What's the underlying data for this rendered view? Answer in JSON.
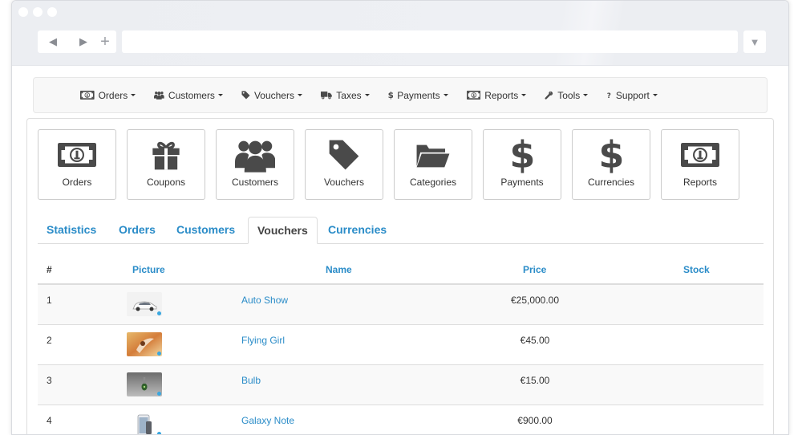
{
  "navbar": {
    "items": [
      {
        "label": "Orders",
        "icon": "money-icon"
      },
      {
        "label": "Customers",
        "icon": "users-icon"
      },
      {
        "label": "Vouchers",
        "icon": "tag-icon"
      },
      {
        "label": "Taxes",
        "icon": "truck-icon"
      },
      {
        "label": "Payments",
        "icon": "dollar-icon"
      },
      {
        "label": "Reports",
        "icon": "money-icon"
      },
      {
        "label": "Tools",
        "icon": "wrench-icon"
      },
      {
        "label": "Support",
        "icon": "question-icon"
      }
    ]
  },
  "tiles": [
    {
      "label": "Orders",
      "icon": "money-icon"
    },
    {
      "label": "Coupons",
      "icon": "gift-icon"
    },
    {
      "label": "Customers",
      "icon": "users-icon"
    },
    {
      "label": "Vouchers",
      "icon": "tag-icon"
    },
    {
      "label": "Categories",
      "icon": "folder-open-icon"
    },
    {
      "label": "Payments",
      "icon": "dollar-icon"
    },
    {
      "label": "Currencies",
      "icon": "dollar-icon"
    },
    {
      "label": "Reports",
      "icon": "money-icon"
    }
  ],
  "tabs": [
    {
      "label": "Statistics",
      "active": false
    },
    {
      "label": "Orders",
      "active": false
    },
    {
      "label": "Customers",
      "active": false
    },
    {
      "label": "Vouchers",
      "active": true
    },
    {
      "label": "Currencies",
      "active": false
    }
  ],
  "table": {
    "headers": {
      "num": "#",
      "picture": "Picture",
      "name": "Name",
      "price": "Price",
      "stock": "Stock"
    },
    "rows": [
      {
        "num": "1",
        "name": "Auto Show",
        "price": "€25,000.00",
        "thumb": "car-thumbnail"
      },
      {
        "num": "2",
        "name": "Flying Girl",
        "price": "€45.00",
        "thumb": "flying-girl-thumbnail"
      },
      {
        "num": "3",
        "name": "Bulb",
        "price": "€15.00",
        "thumb": "bulb-thumbnail"
      },
      {
        "num": "4",
        "name": "Galaxy Note",
        "price": "€900.00",
        "thumb": "phone-thumbnail"
      }
    ]
  },
  "colors": {
    "link": "#2a8cc8",
    "icon": "#4a4a4a",
    "text": "#333333"
  }
}
